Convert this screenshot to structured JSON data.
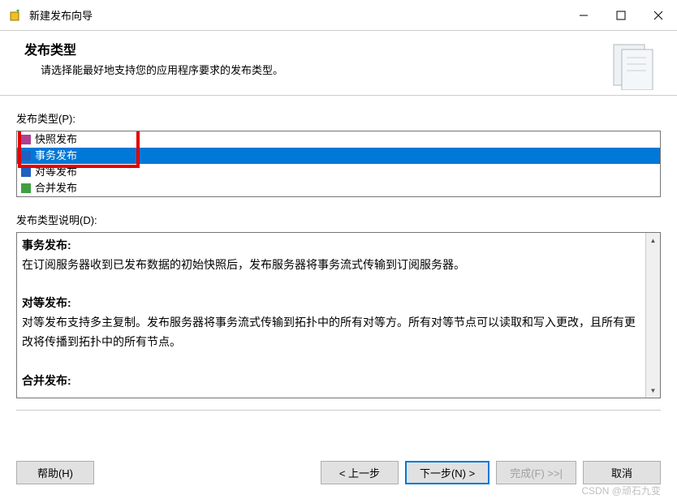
{
  "window": {
    "title": "新建发布向导"
  },
  "header": {
    "title": "发布类型",
    "subtitle": "请选择能最好地支持您的应用程序要求的发布类型。"
  },
  "pubtype": {
    "label": "发布类型(P):",
    "items": [
      {
        "label": "快照发布"
      },
      {
        "label": "事务发布"
      },
      {
        "label": "对等发布"
      },
      {
        "label": "合并发布"
      }
    ],
    "selectedIndex": 1
  },
  "description": {
    "label": "发布类型说明(D):",
    "sections": [
      {
        "title": "事务发布:",
        "body": "在订阅服务器收到已发布数据的初始快照后，发布服务器将事务流式传输到订阅服务器。"
      },
      {
        "title": "对等发布:",
        "body": "对等发布支持多主复制。发布服务器将事务流式传输到拓扑中的所有对等方。所有对等节点可以读取和写入更改，且所有更改将传播到拓扑中的所有节点。"
      },
      {
        "title": "合并发布:",
        "body": ""
      }
    ]
  },
  "buttons": {
    "help": "帮助(H)",
    "back": "< 上一步",
    "next": "下一步(N) >",
    "finish": "完成(F) >>|",
    "cancel": "取消"
  },
  "watermark": "CSDN @顽石九变"
}
